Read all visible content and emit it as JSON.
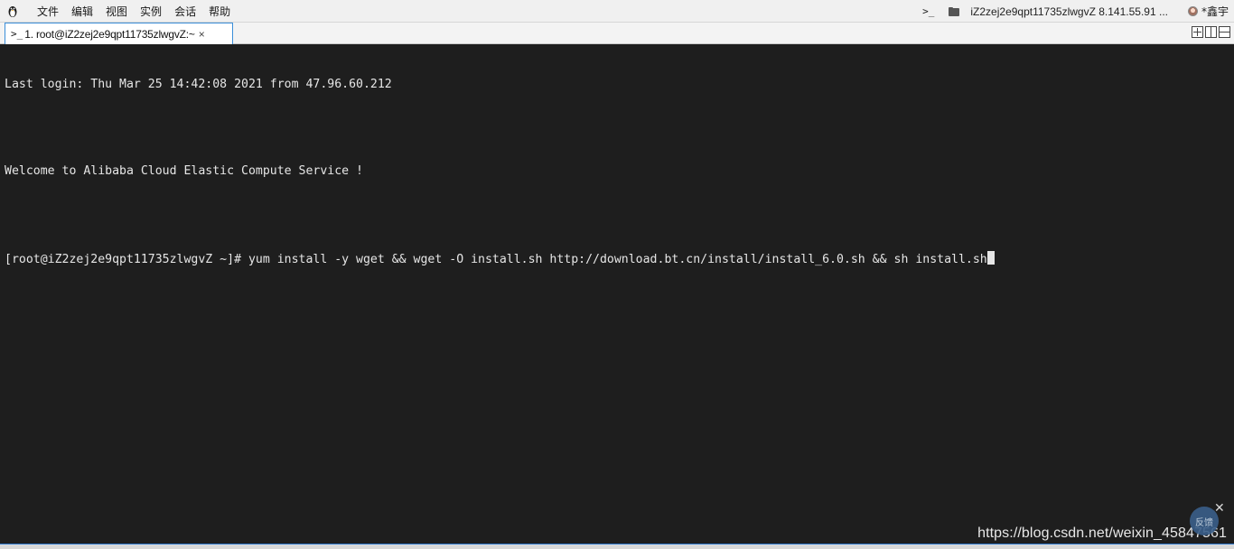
{
  "menubar": {
    "app_icon": "tux-icon",
    "items": [
      "文件",
      "编辑",
      "视图",
      "实例",
      "会话",
      "帮助"
    ],
    "terminal_indicator": ">_",
    "session_title": "iZ2zej2e9qpt11735zlwgvZ 8.141.55.91 ...",
    "user_name": "*鑫宇"
  },
  "tabs": [
    {
      "prompt": ">_",
      "label": "1. root@iZ2zej2e9qpt11735zlwgvZ:~",
      "close": "×"
    }
  ],
  "layout_icons": [
    "new-pane-icon",
    "split-vertical-icon",
    "split-horizontal-icon"
  ],
  "terminal": {
    "lines": [
      "Last login: Thu Mar 25 14:42:08 2021 from 47.96.60.212",
      "",
      "Welcome to Alibaba Cloud Elastic Compute Service !",
      "",
      "[root@iZ2zej2e9qpt11735zlwgvZ ~]# yum install -y wget && wget -O install.sh http://download.bt.cn/install/install_6.0.sh && sh install.sh"
    ]
  },
  "overlay": {
    "watermark": "https://blog.csdn.net/weixin_45847561",
    "feedback_label": "反馈",
    "feedback_close": "✕"
  },
  "colors": {
    "terminal_bg": "#1e1e1e",
    "terminal_fg": "#e6e6e6",
    "tab_active_border": "#3c8fd9",
    "menubar_bg": "#f0f0f0"
  }
}
